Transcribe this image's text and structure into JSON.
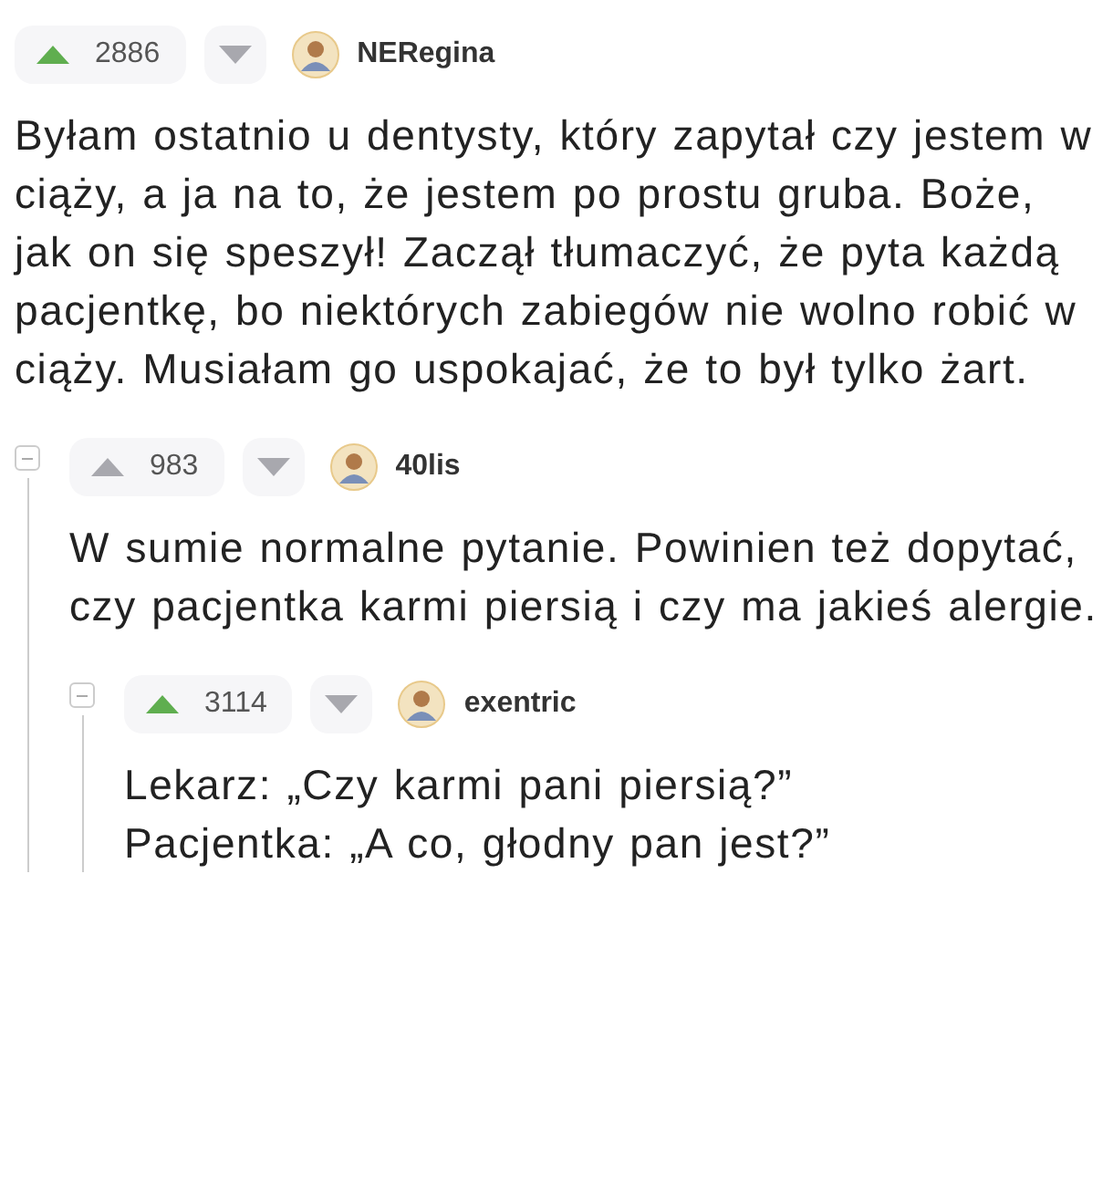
{
  "comments": [
    {
      "votes": "2886",
      "upvoted": true,
      "author": "NERegina",
      "text": "Byłam ostatnio u dentysty, który zapytał czy jestem w ciąży, a ja na to, że jestem po prostu gruba. Boże, jak on się speszył! Zaczął tłumaczyć, że pyta każdą pacjentkę, bo niektórych zabiegów nie wolno robić w ciąży. Musiałam go uspokajać, że to był tylko żart.",
      "children": [
        {
          "votes": "983",
          "upvoted": false,
          "author": "40lis",
          "expanded": true,
          "text": "W sumie normalne pytanie. Powinien też dopytać, czy pacjentka karmi piersią i czy ma jakieś alergie.",
          "children": [
            {
              "votes": "3114",
              "upvoted": true,
              "author": "exentric",
              "expanded": true,
              "text": "Lekarz: „Czy karmi pani piersią?”\nPacjentka: „A co, głodny pan jest?”"
            }
          ]
        }
      ]
    }
  ]
}
